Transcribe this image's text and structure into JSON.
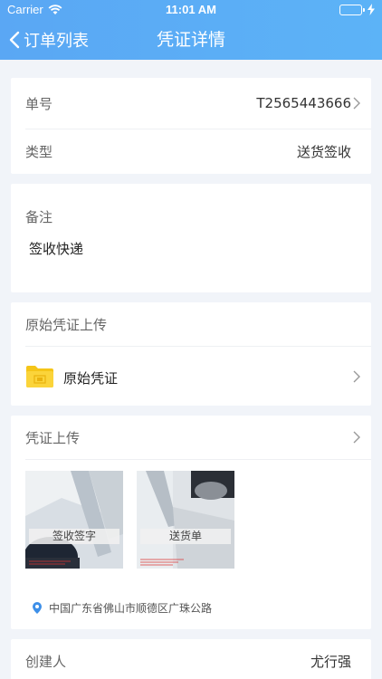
{
  "status_bar": {
    "carrier": "Carrier",
    "time": "11:01 AM"
  },
  "nav": {
    "back_label": "订单列表",
    "title": "凭证详情"
  },
  "order_card": {
    "number_label": "单号",
    "number_value": "T2565443666",
    "type_label": "类型",
    "type_value": "送货签收"
  },
  "remark_card": {
    "label": "备注",
    "text": "签收快递"
  },
  "original_card": {
    "title": "原始凭证上传",
    "file_label": "原始凭证"
  },
  "upload_card": {
    "title": "凭证上传",
    "photos": [
      {
        "caption": "签收签字"
      },
      {
        "caption": "送货单"
      }
    ],
    "address": "中国广东省佛山市顺德区广珠公路"
  },
  "creator_card": {
    "label": "创建人",
    "value": "尤行强"
  },
  "colors": {
    "header": "#5aa7f4",
    "folder": "#f5c518",
    "location": "#3d8fe8"
  }
}
